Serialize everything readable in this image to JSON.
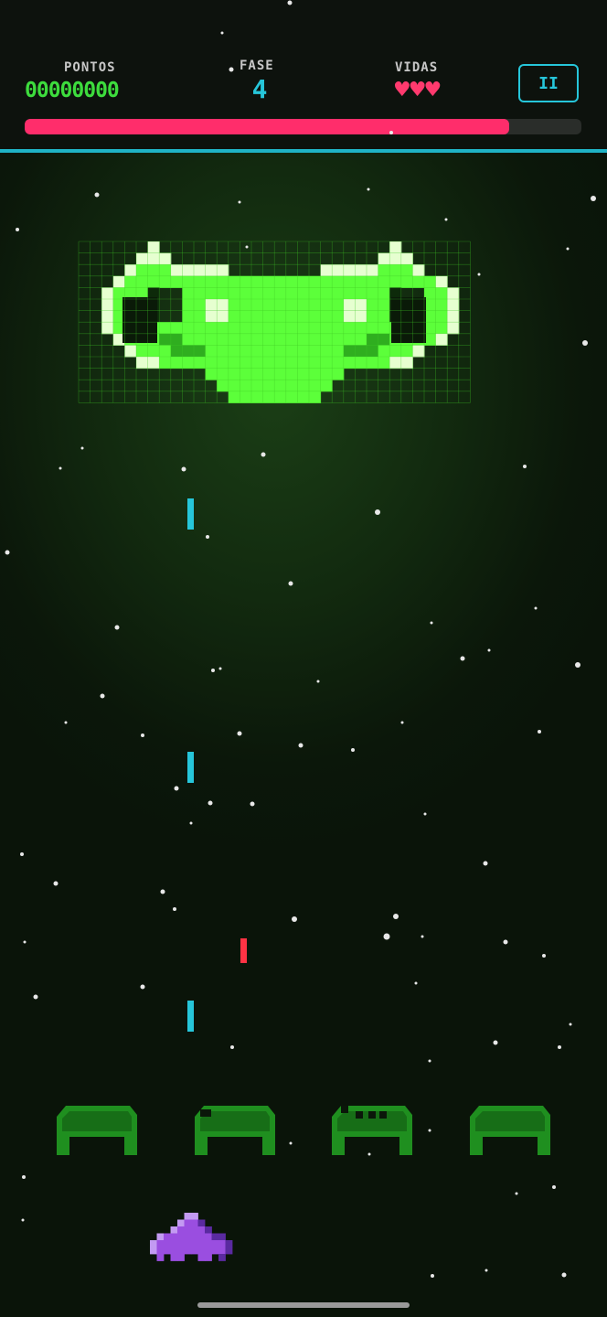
{
  "hud": {
    "score_label": "PONTOS",
    "score_value": "00000000",
    "phase_label": "FASE",
    "phase_value": "4",
    "lives_label": "VIDAS",
    "lives_value": "♥♥♥",
    "lives_count": 3,
    "pause_label": "II",
    "boss_health_fraction": 0.87
  },
  "entities": {
    "boss": "green-alien-mothership",
    "bunkers_count": 4,
    "player_ship": "purple-fighter",
    "player_lasers_count": 3,
    "enemy_lasers_count": 1
  },
  "colors": {
    "score": "#3ddc3d",
    "phase": "#26c6da",
    "lives": "#ff3a6e",
    "health_bar": "#ff2d6b",
    "divider": "#1fb3c6",
    "boss": "#5cff3a",
    "player": "#9a4ee0",
    "bunker": "#1f8f1f",
    "player_laser": "#26c6da",
    "enemy_laser": "#ff3344"
  }
}
